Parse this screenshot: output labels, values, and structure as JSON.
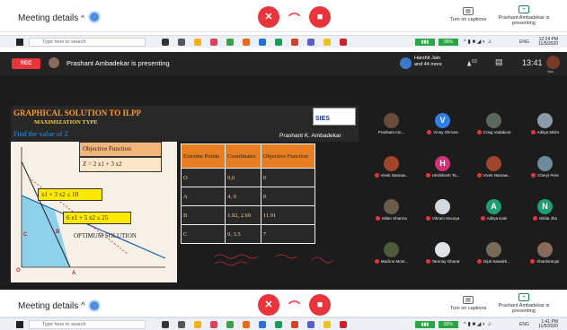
{
  "top_bar": {
    "meeting_details": "Meeting details",
    "chevron": "^",
    "captions_label": "Turn on captions",
    "presenter_label": "Prashant Ambadekar is presenting"
  },
  "taskbar": {
    "search_placeholder": "Type here to search",
    "battery": "96%",
    "lang": "ENG",
    "time": "12:24 PM",
    "date": "11/5/2020"
  },
  "meet": {
    "rec": "REC",
    "presenter_banner": "Prashant Ambadekar is presenting",
    "participant_badge_name": "Harshit Jain",
    "participant_badge_more": "and 44 more",
    "people_count": "53",
    "clock": "13:41",
    "you_label": "You"
  },
  "slide": {
    "title": "GRAPHICAL SOLUTION TO ILPP",
    "subtitle": "MAXIMIZATION TYPE",
    "find_text": "Find the value of Z",
    "logo_text": "SIES",
    "author": "Prashant K. Ambadekar",
    "objective_heading": "Objective Function",
    "objective_eq": "Z = 2 x1 + 3 x2",
    "constraint1": "x1 + 3 x2 ≤ 10",
    "constraint2": "6 x1 + 5 x2 ≤ 25",
    "optimum": "OPTIMUM SOLUTION",
    "point_b": "B",
    "point_c": "C",
    "point_a": "A",
    "point_o": "O",
    "table_headers": [
      "Extreme Points",
      "Coordinates",
      "Objective Function"
    ],
    "table_rows": [
      [
        "O",
        "0,0",
        "0"
      ],
      [
        "A",
        "4, 0",
        "8"
      ],
      [
        "B",
        "1.92, 2.69",
        "11.91"
      ],
      [
        "C",
        "0, 3.5",
        "7"
      ]
    ]
  },
  "participants": [
    {
      "name": "Prashant Am...",
      "color": "#6a4a3a",
      "letter": ""
    },
    {
      "name": "Vinay Shrivas",
      "color": "#2f7fe6",
      "letter": "V"
    },
    {
      "name": "Craig Vadakoot",
      "color": "#5a6a5a",
      "letter": ""
    },
    {
      "name": "Aditya Mishr",
      "color": "#8a9aa8",
      "letter": ""
    },
    {
      "name": "Vivek Namaw...",
      "color": "#a0442a",
      "letter": ""
    },
    {
      "name": "Hrishikesh Ta...",
      "color": "#d1327a",
      "letter": "H"
    },
    {
      "name": "Vivek Namaw...",
      "color": "#a0442a",
      "letter": ""
    },
    {
      "name": "Cheryl Pere",
      "color": "#6b8a9a",
      "letter": ""
    },
    {
      "name": "Milan Sharma",
      "color": "#6a5a4a",
      "letter": ""
    },
    {
      "name": "Vikram Mourya",
      "color": "#d0d8e0",
      "letter": ""
    },
    {
      "name": "Aditya Kale",
      "color": "#1e9e72",
      "letter": "A"
    },
    {
      "name": "Nikita Jha",
      "color": "#1e9e72",
      "letter": "N"
    },
    {
      "name": "Macline Mont...",
      "color": "#4a5a3a",
      "letter": ""
    },
    {
      "name": "Tanmay Gharat",
      "color": "#dfe3e6",
      "letter": ""
    },
    {
      "name": "Dipti Sawakh...",
      "color": "#7a6a5a",
      "letter": ""
    },
    {
      "name": "Shashiranjar",
      "color": "#8a6a5a",
      "letter": ""
    }
  ],
  "bottom_bar": {
    "meeting_details": "Meeting details",
    "captions_label": "Turn on captions",
    "presenter_label": "Prashant Ambadekar is presenting"
  },
  "bottom_taskbar": {
    "search_placeholder": "Type here to search",
    "battery": "82%",
    "lang": "ENG",
    "time": "1:41 PM",
    "date": "11/5/2020"
  }
}
